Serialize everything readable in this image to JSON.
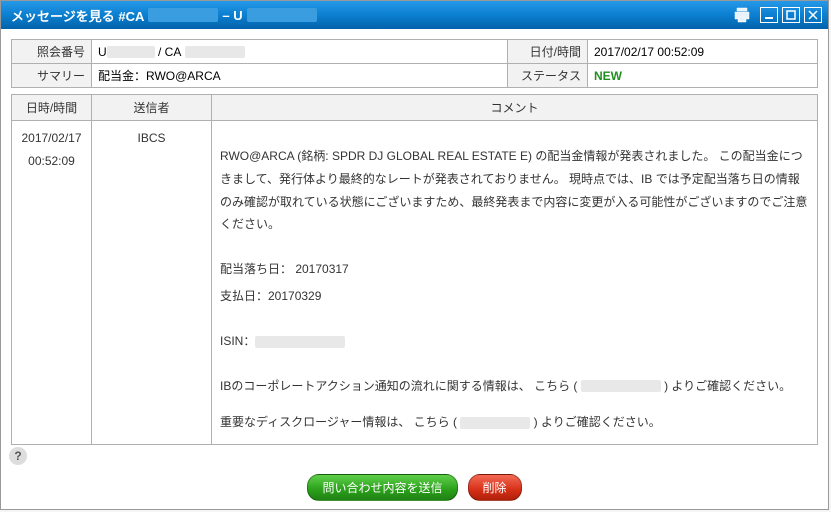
{
  "titlebar": {
    "prefix": "メッセージを見る #CA",
    "sep": "– U"
  },
  "info": {
    "ref_label": "照会番号",
    "ref_value_prefixU": "U",
    "ref_value_sep": " / CA",
    "datetime_label": "日付/時間",
    "datetime_value": "2017/02/17 00:52:09",
    "summary_label": "サマリー",
    "summary_value": "配当金：RWO@ARCA",
    "status_label": "ステータス",
    "status_value": "NEW"
  },
  "table": {
    "header_datetime": "日時/時間",
    "header_sender": "送信者",
    "header_comment": "コメント"
  },
  "row": {
    "dt_line1": "2017/02/17",
    "dt_line2": "00:52:09",
    "sender": "IBCS"
  },
  "comment": {
    "p1": "RWO@ARCA (銘柄: SPDR DJ GLOBAL REAL ESTATE E) の配当金情報が発表されました。 この配当金につきまして、発行体より最終的なレートが発表されておりません。 現時点では、IB では予定配当落ち日の情報のみ確認が取れている状態にございますため、最終発表まで内容に変更が入る可能性がございますのでご注意ください。",
    "p2": "配当落ち日： 20170317",
    "p3": "支払日：20170329",
    "p4_prefix": "ISIN：",
    "p5a": "IBのコーポレートアクション通知の流れに関する情報は、 こちら ( ",
    "p5b": " ) よりご確認ください。",
    "p6a": "重要なディスクロージャー情報は、 こちら ( ",
    "p6b": " ) よりご確認ください。"
  },
  "buttons": {
    "send": "問い合わせ内容を送信",
    "delete": "削除"
  }
}
